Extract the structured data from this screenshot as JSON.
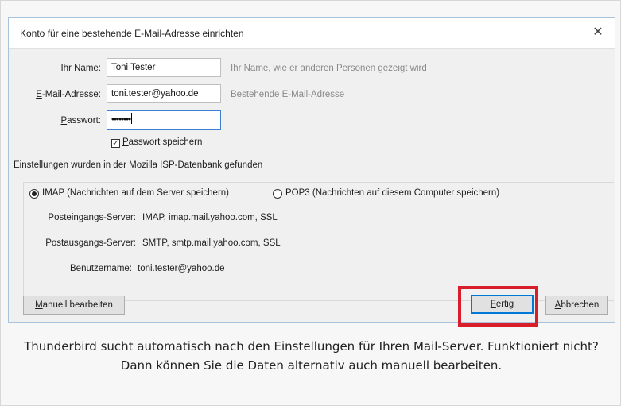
{
  "dialog": {
    "title": "Konto für eine bestehende E-Mail-Adresse einrichten",
    "close_glyph": "✕"
  },
  "form": {
    "name": {
      "label_accel": "N",
      "label_pre": "Ihr ",
      "label_post": "ame:",
      "value": "Toni Tester",
      "hint": "Ihr Name, wie er anderen Personen gezeigt wird"
    },
    "email": {
      "label_accel": "E",
      "label_post": "-Mail-Adresse:",
      "value": "toni.tester@yahoo.de",
      "hint": "Bestehende E-Mail-Adresse"
    },
    "password": {
      "label_accel": "P",
      "label_post": "asswort:",
      "value": "••••••••"
    },
    "save_password": {
      "checked": true,
      "check_glyph": "✓",
      "label_accel": "P",
      "label_post": "asswort speichern"
    }
  },
  "status_text": "Einstellungen wurden in der Mozilla ISP-Datenbank gefunden",
  "protocol": {
    "selected": "imap",
    "imap_label": "IMAP (Nachrichten auf dem Server speichern)",
    "pop3_label": "POP3 (Nachrichten auf diesem Computer speichern)"
  },
  "server": {
    "incoming_label": "Posteingangs-Server:",
    "incoming_value": "IMAP, imap.mail.yahoo.com, SSL",
    "outgoing_label": "Postausgangs-Server:",
    "outgoing_value": "SMTP, smtp.mail.yahoo.com, SSL",
    "username_label": "Benutzername:",
    "username_value": "toni.tester@yahoo.de"
  },
  "buttons": {
    "manual_accel": "M",
    "manual_post": "anuell bearbeiten",
    "done_accel": "F",
    "done_post": "ertig",
    "cancel_accel": "A",
    "cancel_post": "bbrechen"
  },
  "caption": "Thunderbird sucht automatisch nach den Einstellungen für Ihren Mail-Server. Funktioniert nicht? Dann können Sie die Daten alternativ auch manuell bearbeiten.",
  "colors": {
    "highlight_frame": "#d91e2b",
    "focus_border": "#3c7fd8",
    "default_button_border": "#0078d7"
  }
}
